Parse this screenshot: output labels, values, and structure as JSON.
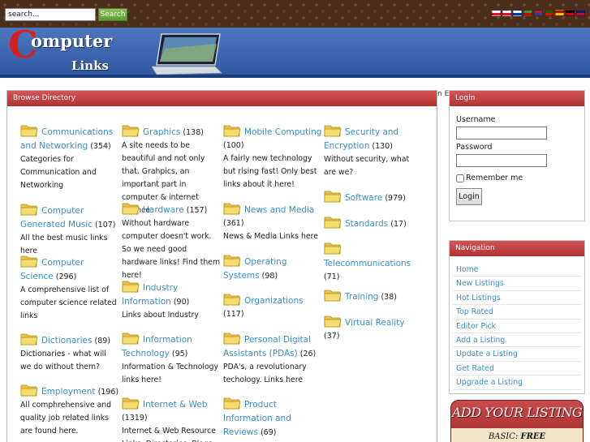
{
  "search": {
    "placeholder": "search...",
    "value": "search...",
    "button_label": "Search"
  },
  "flags": [
    {
      "name": "georgia-flag-icon",
      "c1": "#ffffff",
      "c2": "#e8112d"
    },
    {
      "name": "poland-flag-icon",
      "c1": "#ffffff",
      "c2": "#dc143c"
    },
    {
      "name": "russia-flag-icon",
      "c1": "#ffffff",
      "c2": "#0039a6"
    },
    {
      "name": "iran-flag-icon",
      "c1": "#239f40",
      "c2": "#da0000"
    },
    {
      "name": "netherlands-flag-icon",
      "c1": "#ae1c28",
      "c2": "#21468b"
    },
    {
      "name": "portugal-flag-icon",
      "c1": "#006600",
      "c2": "#ff0000"
    },
    {
      "name": "spain-flag-icon",
      "c1": "#aa151b",
      "c2": "#f1bf00"
    },
    {
      "name": "germany-flag-icon",
      "c1": "#000000",
      "c2": "#dd0000"
    },
    {
      "name": "uk-flag-icon",
      "c1": "#012169",
      "c2": "#c8102e"
    }
  ],
  "logo": {
    "letter": "C",
    "word": "omputer",
    "sub": "Links"
  },
  "browse": {
    "title": "Browse Directory",
    "overflow_text": "n E",
    "categories": [
      {
        "name": "Communications and Networking",
        "count": "(354)",
        "desc": "Categories for Communication and Networking"
      },
      {
        "name": "Computer Generated Music",
        "count": "(107)",
        "desc": "All the best music links here"
      },
      {
        "name": "Computer Science",
        "count": "(296)",
        "desc": "A comprehensive list of computer science related links"
      },
      {
        "name": "Dictionaries",
        "count": "(89)",
        "desc": "Dictionaries - what will we do without them?"
      },
      {
        "name": "Employment",
        "count": "(196)",
        "desc": "All comphrehensive and quality job related links are found here."
      },
      {
        "name": "Graphics",
        "count": "(138)",
        "desc": "A site needs to be beautiful and not only that. Grahpics, an important part in computer & internet science"
      },
      {
        "name": "Hardware",
        "count": "(157)",
        "desc": "Without hardware computer doesn't work. So we need good hardware links! Find them here!"
      },
      {
        "name": "Industry Information",
        "count": "(90)",
        "desc": "Links about Industry"
      },
      {
        "name": "Information Technology",
        "count": "(95)",
        "desc": "Information & Technology links here!"
      },
      {
        "name": "Internet & Web",
        "count": "(1319)",
        "desc": "Internet & Web Resource Links, Directories, Blogs"
      },
      {
        "name": "Mobile Computing",
        "count": "(100)",
        "desc": "A fairly new technology but rising fast! Only best links about it here!"
      },
      {
        "name": "News and Media",
        "count": "(361)",
        "desc": "News & Media Links here"
      },
      {
        "name": "Operating Systems",
        "count": "(98)",
        "desc": ""
      },
      {
        "name": "Organizations",
        "count": "(117)",
        "desc": ""
      },
      {
        "name": "Personal Digital Assistants (PDAs)",
        "count": "(26)",
        "desc": "PDA's, a revolutionary techology. Links here"
      },
      {
        "name": "Product Information and Reviews",
        "count": "(69)",
        "desc": ""
      },
      {
        "name": "Security and Encryption",
        "count": "(130)",
        "desc": "Without security, what are we?"
      },
      {
        "name": "Software",
        "count": "(979)",
        "desc": ""
      },
      {
        "name": "Standards",
        "count": "(17)",
        "desc": ""
      },
      {
        "name": "Telecommunications",
        "count": "(71)",
        "desc": ""
      },
      {
        "name": "Training",
        "count": "(38)",
        "desc": ""
      },
      {
        "name": "Virtual Reality",
        "count": "(37)",
        "desc": ""
      }
    ]
  },
  "login": {
    "title": "Login",
    "username_label": "Username",
    "password_label": "Password",
    "remember_label": "Remember me",
    "button_label": "Login"
  },
  "navigation": {
    "title": "Navigation",
    "items": [
      "Home",
      "New Listings",
      "Hot Listings",
      "Top Rated",
      "Editor Pick",
      "Add a Listing",
      "Update a Listing",
      "Get Rated",
      "Upgrade a Listing"
    ]
  },
  "add_listing": {
    "title": "ADD YOUR LISTING",
    "basic_label": "BASIC:",
    "basic_price": "FREE"
  }
}
